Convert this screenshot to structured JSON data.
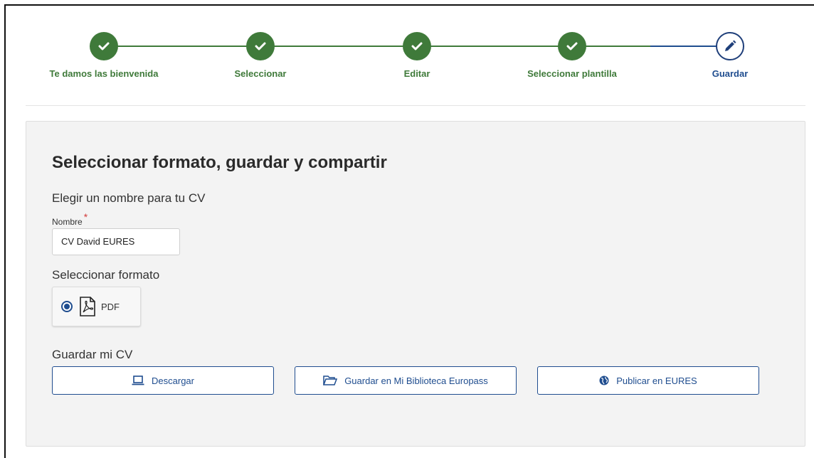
{
  "stepper": {
    "steps": [
      {
        "label": "Te damos las bienvenida",
        "state": "done"
      },
      {
        "label": "Seleccionar",
        "state": "done"
      },
      {
        "label": "Editar",
        "state": "done"
      },
      {
        "label": "Seleccionar plantilla",
        "state": "done"
      },
      {
        "label": "Guardar",
        "state": "active"
      }
    ]
  },
  "main": {
    "title": "Seleccionar formato, guardar y compartir",
    "name_section": "Elegir un nombre para tu CV",
    "name_field": {
      "label": "Nombre",
      "required_mark": "*",
      "value": "CV David EURES"
    },
    "format_section": "Seleccionar formato",
    "format_option": {
      "label": "PDF",
      "selected": true
    },
    "save_section": "Guardar mi CV",
    "buttons": {
      "download": "Descargar",
      "save_library": "Guardar en Mi Biblioteca Europass",
      "publish": "Publicar en EURES"
    }
  },
  "colors": {
    "done": "#3f7a3a",
    "active": "#1f4d8f",
    "panel_bg": "#f3f3f3"
  }
}
